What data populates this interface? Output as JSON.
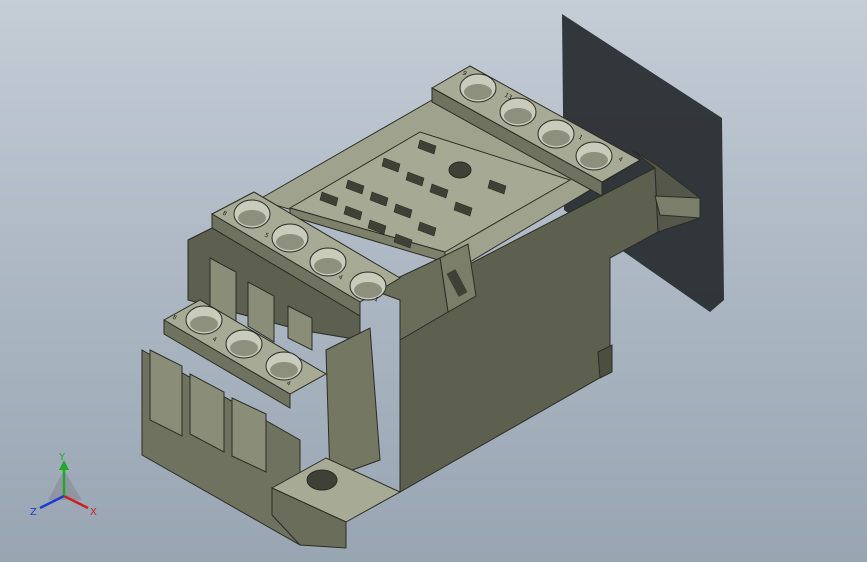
{
  "viewport": {
    "background_top": "#c5cdd6",
    "background_bottom": "#98a5b2"
  },
  "model": {
    "body_color": "#6f725f",
    "top_color": "#9fa28c",
    "side_color": "#5e604f",
    "dark_face": "#3f4136",
    "hole_color": "#c9cbbb",
    "shadow_color": "#262a2f"
  },
  "terminal_marks": {
    "upper_right": [
      "9",
      "13",
      "1",
      "4"
    ],
    "upper_left": [
      "8",
      "5",
      "4",
      "1"
    ],
    "lower_left": [
      "8",
      "4",
      "4"
    ]
  },
  "triad": {
    "x_label": "X",
    "y_label": "Y",
    "z_label": "Z",
    "x_color": "#d11f1f",
    "y_color": "#1fa82a",
    "z_color": "#1f3ad1"
  }
}
